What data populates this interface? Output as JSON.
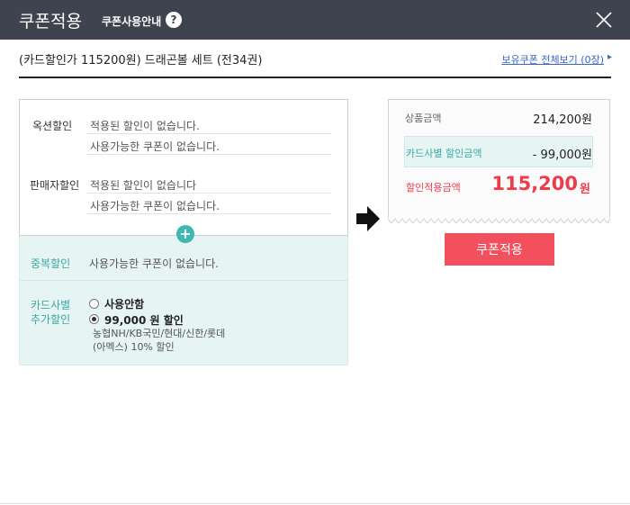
{
  "header": {
    "title": "쿠폰적용",
    "guide_label": "쿠폰사용안내",
    "help_glyph": "?"
  },
  "product": {
    "name": "(카드할인가 115200원) 드래곤볼 세트 (전34권)",
    "all_coupons_link": "보유쿠폰 전체보기 (0장)",
    "arrow_glyph": "▸"
  },
  "discounts": {
    "option": {
      "label": "옥션할인",
      "applied": "적용된 할인이 없습니다.",
      "available": "사용가능한 쿠폰이 없습니다."
    },
    "seller": {
      "label": "판매자할인",
      "applied": "적용된 할인이 없습니다",
      "available": "사용가능한 쿠폰이 없습니다."
    },
    "plus_glyph": "+",
    "duplicate": {
      "label": "중복할인",
      "text": "사용가능한 쿠폰이 없습니다."
    },
    "card": {
      "label_line1": "카드사별",
      "label_line2": "추가할인",
      "option_none": "사용안함",
      "option_discount": "99,000 원 할인",
      "desc_line1": "농협NH/KB국민/현대/신한/롯데",
      "desc_line2": "(아멕스) 10% 할인",
      "selected": "option_discount"
    }
  },
  "summary": {
    "product_amount_label": "상품금액",
    "product_amount": "214,200원",
    "card_discount_label": "카드사별 할인금액",
    "card_discount": "- 99,000원",
    "final_label": "할인적용금액",
    "final_amount": "115,200",
    "final_unit": "원",
    "apply_button": "쿠폰적용"
  },
  "colors": {
    "header_bg": "#3f4350",
    "teal": "#3fb8b5",
    "teal_bg": "#e6f4f3",
    "accent_red": "#ef3b4c",
    "link_blue": "#3b66c4"
  }
}
